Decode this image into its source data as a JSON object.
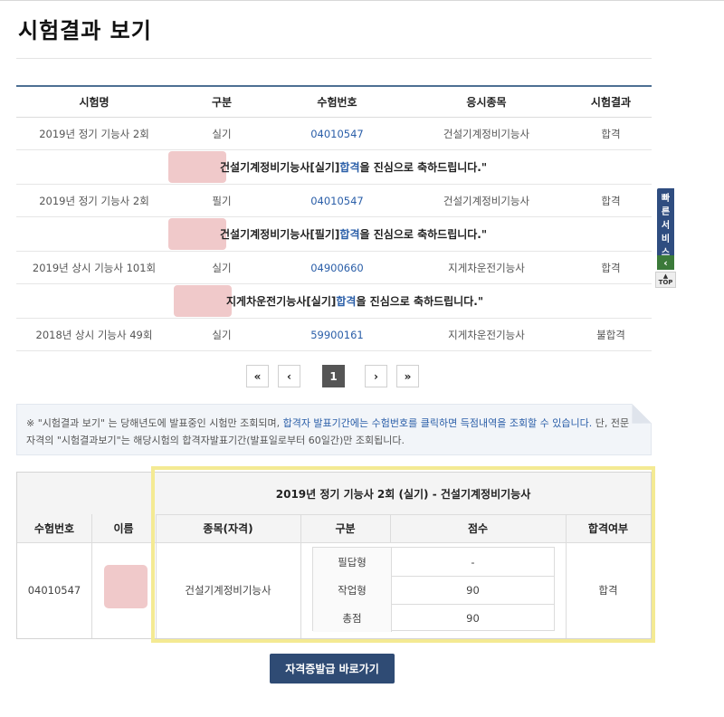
{
  "page_title": "시험결과 보기",
  "results": {
    "headers": [
      "시험명",
      "구분",
      "수험번호",
      "응시종목",
      "시험결과"
    ],
    "rows": [
      {
        "exam": "2019년 정기 기능사 2회",
        "type": "실기",
        "number": "04010547",
        "field": "건설기계정비기능사",
        "result": "합격",
        "msg_pre": "건설기계정비기능사[실기] ",
        "msg_hl": "합격",
        "msg_post": "을 진심으로 축하드립니다.\""
      },
      {
        "exam": "2019년 정기 기능사 2회",
        "type": "필기",
        "number": "04010547",
        "field": "건설기계정비기능사",
        "result": "합격",
        "msg_pre": "건설기계정비기능사[필기] ",
        "msg_hl": "합격",
        "msg_post": "을 진심으로 축하드립니다.\""
      },
      {
        "exam": "2019년 상시 기능사 101회",
        "type": "실기",
        "number": "04900660",
        "field": "지게차운전기능사",
        "result": "합격",
        "msg_pre": "지게차운전기능사[실기] ",
        "msg_hl": "합격",
        "msg_post": "을 진심으로 축하드립니다.\""
      },
      {
        "exam": "2018년 상시 기능사 49회",
        "type": "실기",
        "number": "59900161",
        "field": "지게차운전기능사",
        "result": "불합격"
      }
    ]
  },
  "quick_service": {
    "label_chars": [
      "빠",
      "른",
      "서",
      "비",
      "스"
    ],
    "arrow": "‹",
    "top_label": "TOP"
  },
  "pagination": {
    "first": "«",
    "prev": "‹",
    "current": "1",
    "next": "›",
    "last": "»"
  },
  "notice": {
    "mark": "※",
    "part1": " \"시험결과 보기\" 는 당해년도에 발표중인 시험만 조회되며, ",
    "highlight": "합격자 발표기간에는 수험번호를 클릭하면 득점내역을 조회할 수 있습니다.",
    "part2": " 단, 전문자격의 \"시험결과보기\"는 해당시험의 합격자발표기간(발표일로부터 60일간)만 조회됩니다."
  },
  "score": {
    "title": "2019년 정기 기능사 2회 (실기) - 건설기계정비기능사",
    "headers": {
      "number": "수험번호",
      "name": "이름",
      "field": "종목(자격)",
      "type": "구분",
      "score": "점수",
      "pass": "합격여부"
    },
    "number": "04010547",
    "field": "건설기계정비기능사",
    "items": [
      {
        "label": "필답형",
        "value": "-"
      },
      {
        "label": "작업형",
        "value": "90"
      },
      {
        "label": "총점",
        "value": "90"
      }
    ],
    "pass": "합격"
  },
  "issue_button": "자격증발급 바로가기",
  "colors": {
    "accent": "#2a5ea8",
    "header_rule": "#4d6f93",
    "button": "#2f4b74",
    "highlight_border": "#f4ea93"
  }
}
